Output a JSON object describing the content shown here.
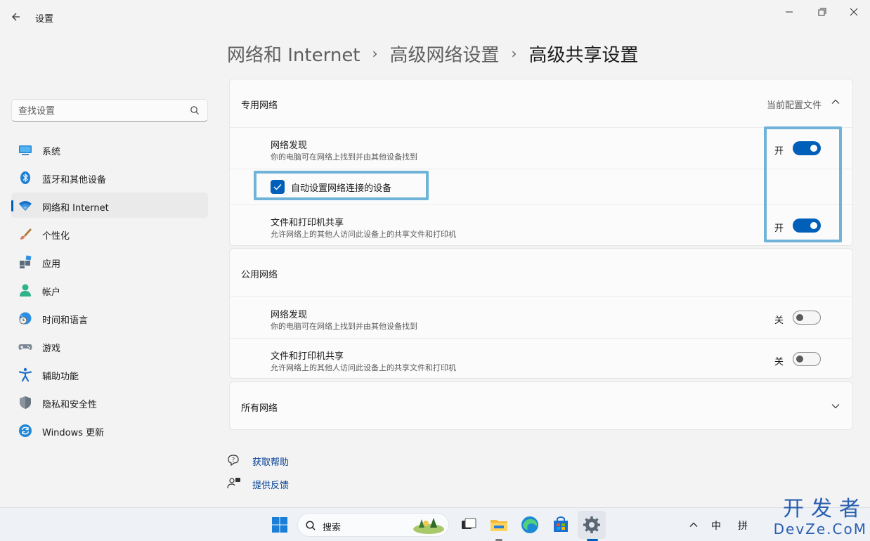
{
  "window": {
    "title": "设置",
    "controls": {
      "minimize": "—",
      "maximize": "❐",
      "close": "✕"
    }
  },
  "sidebar": {
    "search_placeholder": "查找设置",
    "items": [
      {
        "label": "系统",
        "icon": "system-icon"
      },
      {
        "label": "蓝牙和其他设备",
        "icon": "bluetooth-icon"
      },
      {
        "label": "网络和 Internet",
        "icon": "wifi-icon",
        "active": true
      },
      {
        "label": "个性化",
        "icon": "brush-icon"
      },
      {
        "label": "应用",
        "icon": "apps-icon"
      },
      {
        "label": "帐户",
        "icon": "account-icon"
      },
      {
        "label": "时间和语言",
        "icon": "globe-clock-icon"
      },
      {
        "label": "游戏",
        "icon": "gamepad-icon"
      },
      {
        "label": "辅助功能",
        "icon": "accessibility-icon"
      },
      {
        "label": "隐私和安全性",
        "icon": "shield-icon"
      },
      {
        "label": "Windows 更新",
        "icon": "update-icon"
      }
    ]
  },
  "breadcrumb": [
    "网络和 Internet",
    "高级网络设置",
    "高级共享设置"
  ],
  "breadcrumb_sep": "›",
  "private_network": {
    "title": "专用网络",
    "meta": "当前配置文件",
    "discovery": {
      "title": "网络发现",
      "desc": "你的电脑可在网络上找到并由其他设备找到",
      "state_label": "开",
      "on": true
    },
    "auto_setup": {
      "label": "自动设置网络连接的设备",
      "checked": true
    },
    "sharing": {
      "title": "文件和打印机共享",
      "desc": "允许网络上的其他人访问此设备上的共享文件和打印机",
      "state_label": "开",
      "on": true
    }
  },
  "public_network": {
    "title": "公用网络",
    "discovery": {
      "title": "网络发现",
      "desc": "你的电脑可在网络上找到并由其他设备找到",
      "state_label": "关",
      "on": false
    },
    "sharing": {
      "title": "文件和打印机共享",
      "desc": "允许网络上的其他人访问此设备上的共享文件和打印机",
      "state_label": "关",
      "on": false
    }
  },
  "all_networks": {
    "title": "所有网络"
  },
  "help": {
    "get_help": "获取帮助",
    "feedback": "提供反馈"
  },
  "taskbar": {
    "search_label": "搜索",
    "tray": {
      "chevron": "^",
      "ime_mode": "中",
      "ime_name": "拼"
    }
  },
  "watermark": {
    "line1": "开发者",
    "line2": "DevZe.CoM"
  },
  "colors": {
    "accent": "#005fb8",
    "highlight": "#6fb3d8",
    "link": "#003e92"
  }
}
